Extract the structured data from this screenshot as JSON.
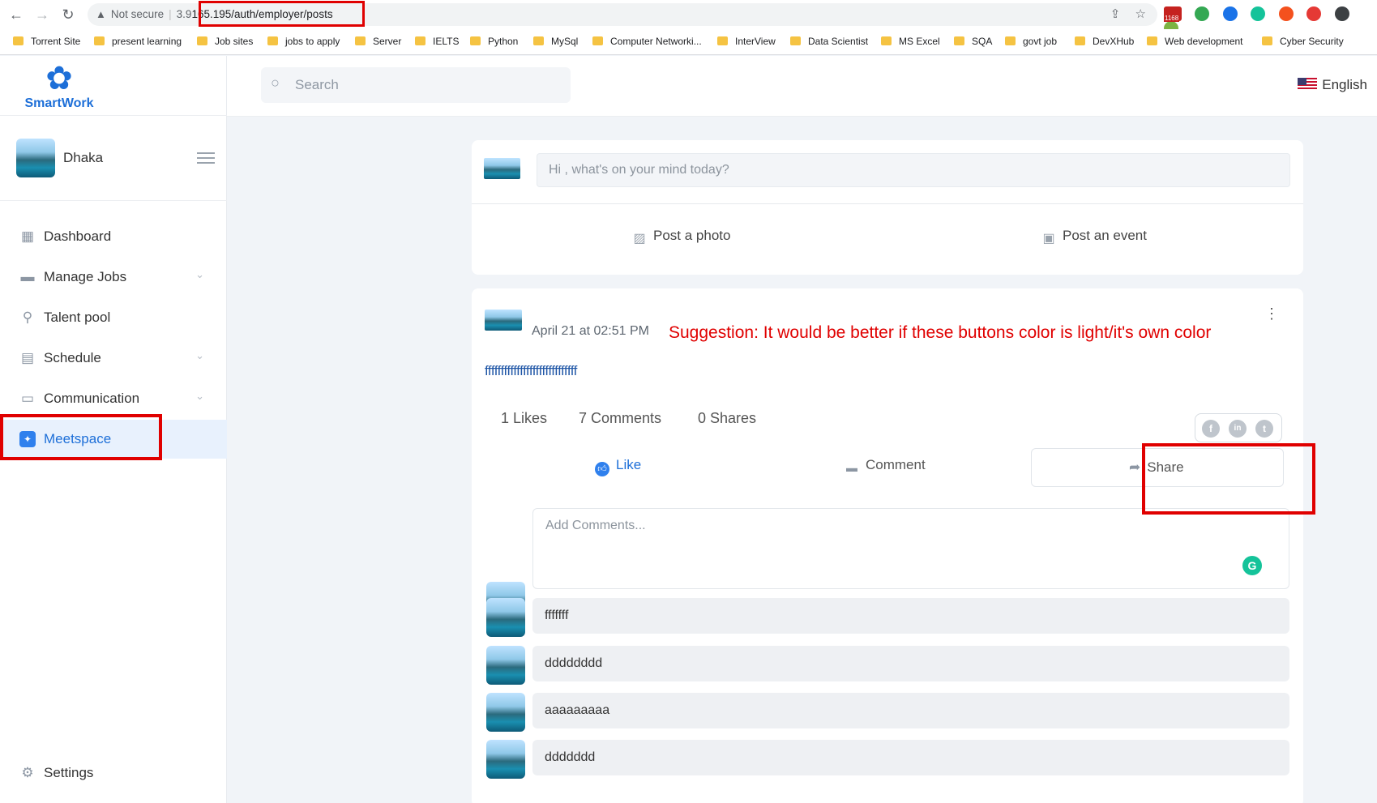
{
  "browser": {
    "not_secure": "Not secure",
    "url_prefix": "3.9",
    "url_rest": "165.195/auth/employer/posts",
    "gmail_count": "1168",
    "bookmarks": [
      "Torrent Site",
      "present learning",
      "Job sites",
      "jobs to apply",
      "Server",
      "IELTS",
      "Python",
      "MySql",
      "Computer Networki...",
      "InterView",
      "Data Scientist",
      "MS Excel",
      "SQA",
      "govt job",
      "DevXHub",
      "Web development",
      "Cyber Security"
    ]
  },
  "app": {
    "brand": "SmartWork",
    "brand_color": "#1d6fd8",
    "user_name": "Dhaka",
    "search_placeholder": "Search",
    "language": "English"
  },
  "sidebar": {
    "items": [
      {
        "label": "Dashboard",
        "icon": "dashboard-icon"
      },
      {
        "label": "Manage Jobs",
        "icon": "briefcase-icon"
      },
      {
        "label": "Talent pool",
        "icon": "talent-search-icon"
      },
      {
        "label": "Schedule",
        "icon": "calendar-icon"
      },
      {
        "label": "Communication",
        "icon": "chat-icon"
      },
      {
        "label": "Meetspace",
        "icon": "meetspace-icon",
        "active": true
      }
    ],
    "settings": "Settings"
  },
  "composer": {
    "placeholder": "Hi , what's on your mind today?",
    "post_photo": "Post a photo",
    "post_event": "Post an event"
  },
  "post": {
    "date": "April 21 at 02:51 PM",
    "annotation": "Suggestion: It would be better if these buttons color is light/it's own color",
    "body": "fffffffffffffffffffffffffffff",
    "likes": "1 Likes",
    "comments": "7 Comments",
    "shares": "0 Shares",
    "like_label": "Like",
    "comment_label": "Comment",
    "share_label": "Share",
    "social": [
      "facebook-icon",
      "linkedin-icon",
      "twitter-icon"
    ]
  },
  "comments": {
    "placeholder": "Add Comments...",
    "items": [
      "fffffff",
      "dddddddd",
      "aaaaaaaaa",
      "ddddddd"
    ]
  },
  "annotation_color": "#e00000"
}
